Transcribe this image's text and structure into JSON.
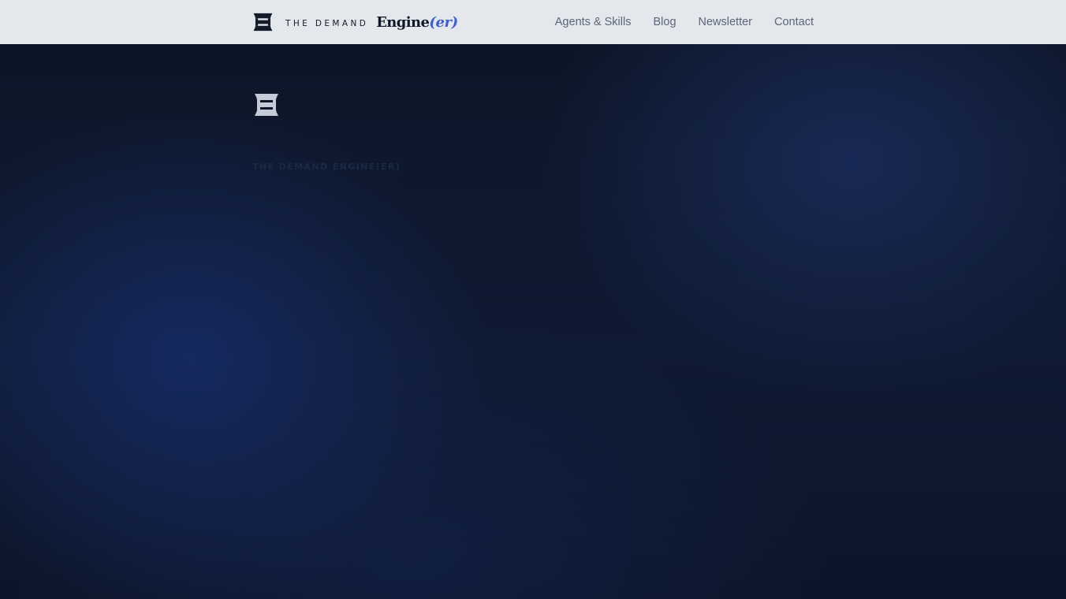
{
  "navbar": {
    "brand": {
      "prefix": "THE DEMAND",
      "word": "Engine",
      "suffix": "(er)",
      "mark_icon": "brand-mark-icon"
    },
    "links": [
      {
        "label": "Agents & Skills"
      },
      {
        "label": "Blog"
      },
      {
        "label": "Newsletter"
      },
      {
        "label": "Contact"
      }
    ]
  },
  "hero": {
    "mark_icon": "brand-mark-icon",
    "eyebrow": "THE DEMAND ENGINE(ER)"
  },
  "colors": {
    "nav_background": "#e4e7ec",
    "nav_text": "#5c6579",
    "brand_dark": "#101726",
    "brand_accent": "#3a5fd6",
    "hero_background": "#0d1628",
    "hero_mark": "#c5cbd6"
  }
}
